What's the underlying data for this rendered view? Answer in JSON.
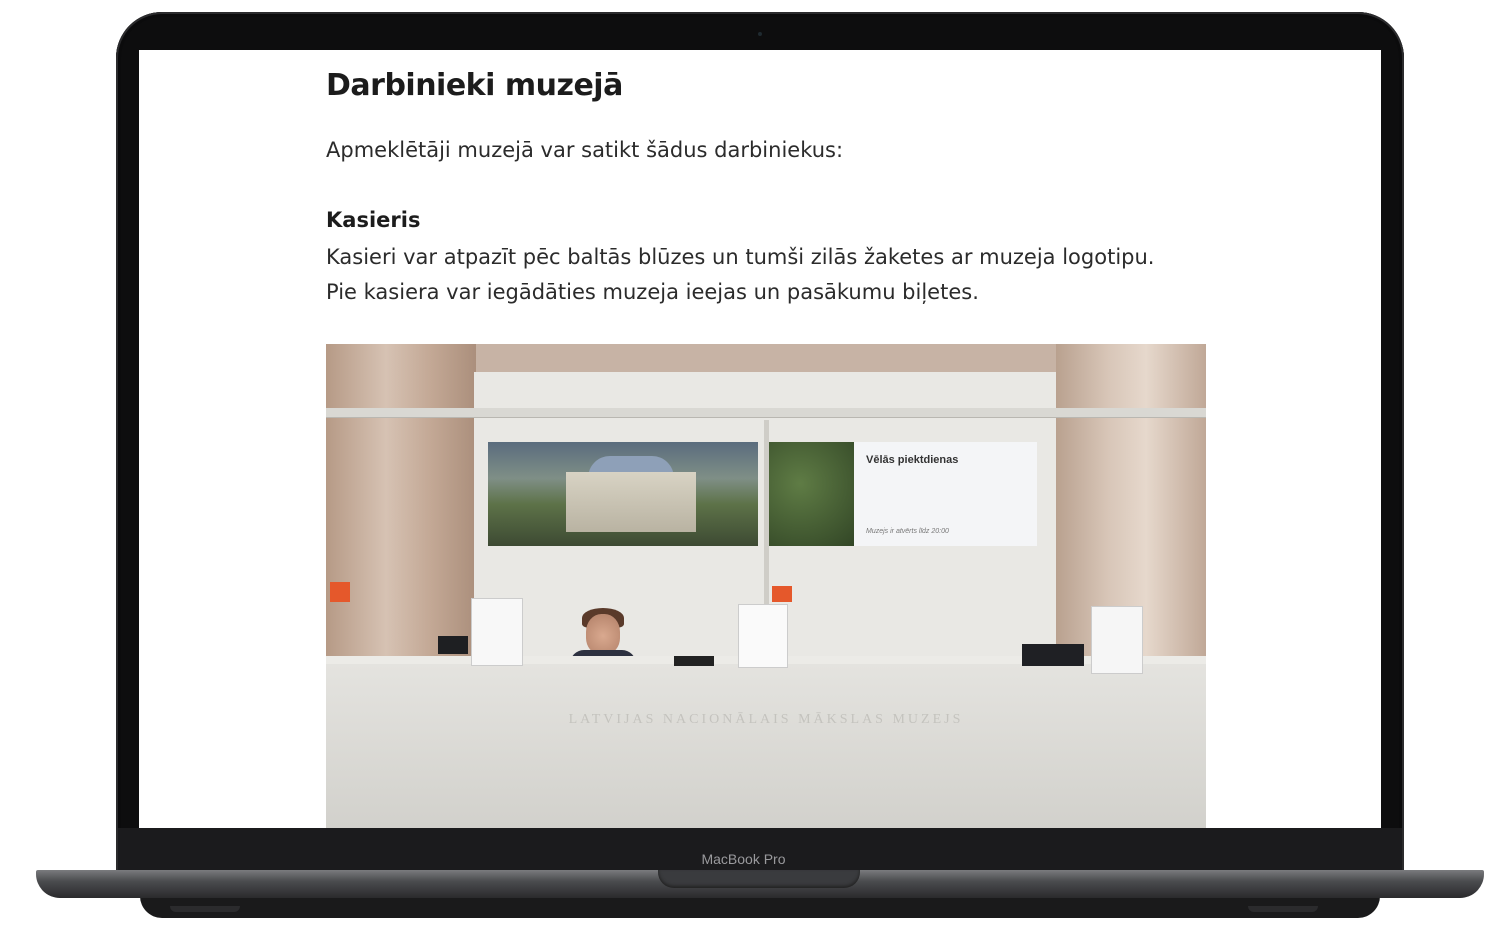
{
  "device": {
    "model_label": "MacBook Pro"
  },
  "page": {
    "title": "Darbinieki muzejā",
    "intro": "Apmeklētāji muzejā var satikt šādus darbiniekus:",
    "role": {
      "title": "Kasieris",
      "description_line1": "Kasieri var atpazīt pēc baltās blūzes un tumši zilās žaketes ar muzeja logotipu.",
      "description_line2": "Pie kasiera var iegādāties muzeja ieejas un pasākumu biļetes."
    }
  },
  "photo": {
    "screen_title": "Vēlās piektdienas",
    "screen_subtitle": "Muzejs ir atvērts līdz 20:00",
    "desk_engraving": "LATVIJAS NACIONĀLAIS MĀKSLAS MUZEJS"
  },
  "colors": {
    "frame": "#0d0d0e",
    "page_background": "#ffffff",
    "text": "#2b2b2b",
    "accent_orange": "#e5582b"
  }
}
